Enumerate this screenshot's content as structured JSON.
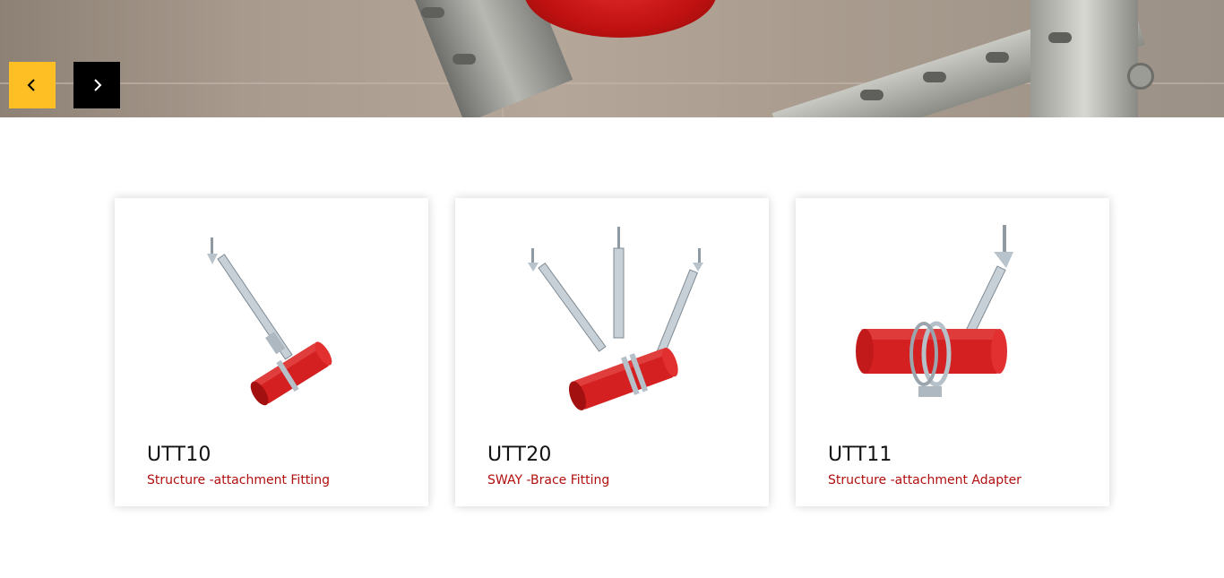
{
  "slider": {
    "prev_icon": "chevron-left-icon",
    "next_icon": "chevron-right-icon",
    "prev_color": "#fdbf24",
    "next_color": "#000000"
  },
  "products": [
    {
      "code": "UTT10",
      "description": "Structure -attachment Fitting"
    },
    {
      "code": "UTT20",
      "description": "SWAY -Brace Fitting"
    },
    {
      "code": "UTT11",
      "description": "Structure -attachment Adapter"
    }
  ],
  "colors": {
    "accent_red": "#b10f0f",
    "pipe_red": "#d42020",
    "accent_yellow": "#fdbf24"
  }
}
